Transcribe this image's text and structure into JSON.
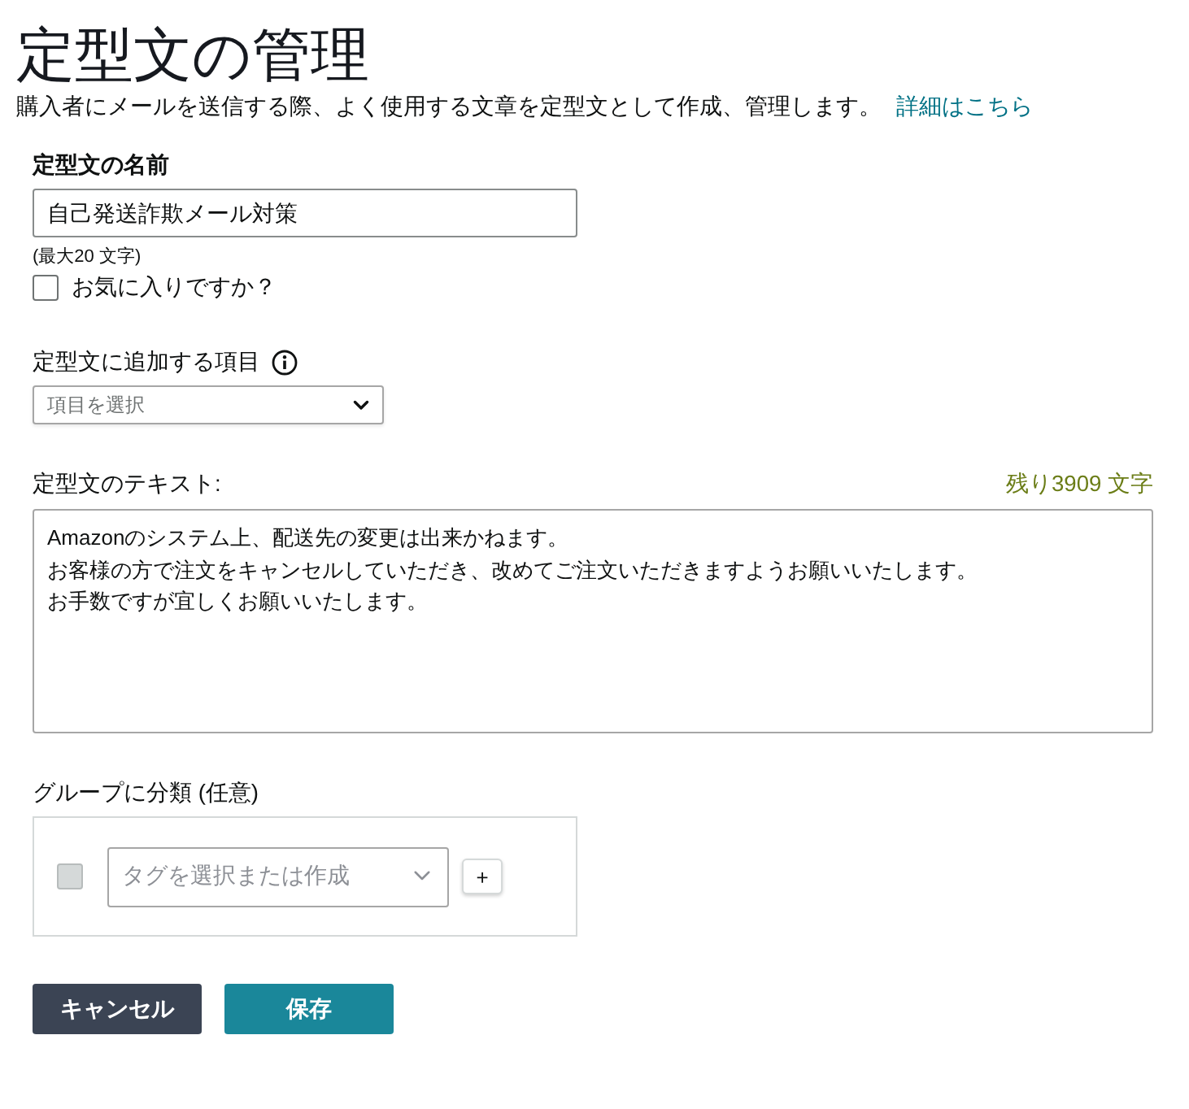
{
  "header": {
    "title": "定型文の管理",
    "description": "購入者にメールを送信する際、よく使用する文章を定型文として作成、管理します。",
    "help_link": "詳細はこちら"
  },
  "name_field": {
    "label": "定型文の名前",
    "value": "自己発送詐欺メール対策",
    "hint": "(最大20 文字)"
  },
  "favorite": {
    "label": "お気に入りですか？",
    "checked": false
  },
  "insert_field": {
    "label": "定型文に追加する項目",
    "placeholder": "項目を選択"
  },
  "message": {
    "label": "定型文のテキスト:",
    "remaining": "残り3909 文字",
    "lines": [
      "Amazonのシステム上、配送先の変更は出来かねます。",
      "お客様の方で注文をキャンセルしていただき、改めてご注文いただきますようお願いいたします。",
      "お手数ですが宜しくお願いいたします。"
    ]
  },
  "group": {
    "label": "グループに分類 (任意)",
    "checkbox": {
      "checked": false,
      "disabled": true
    },
    "tag_select": {
      "placeholder": "タグを選択または作成"
    },
    "add_button": "+"
  },
  "buttons": [
    {
      "kind": "secondary",
      "label": "キャンセル"
    },
    {
      "kind": "primary",
      "label": "保存"
    }
  ]
}
